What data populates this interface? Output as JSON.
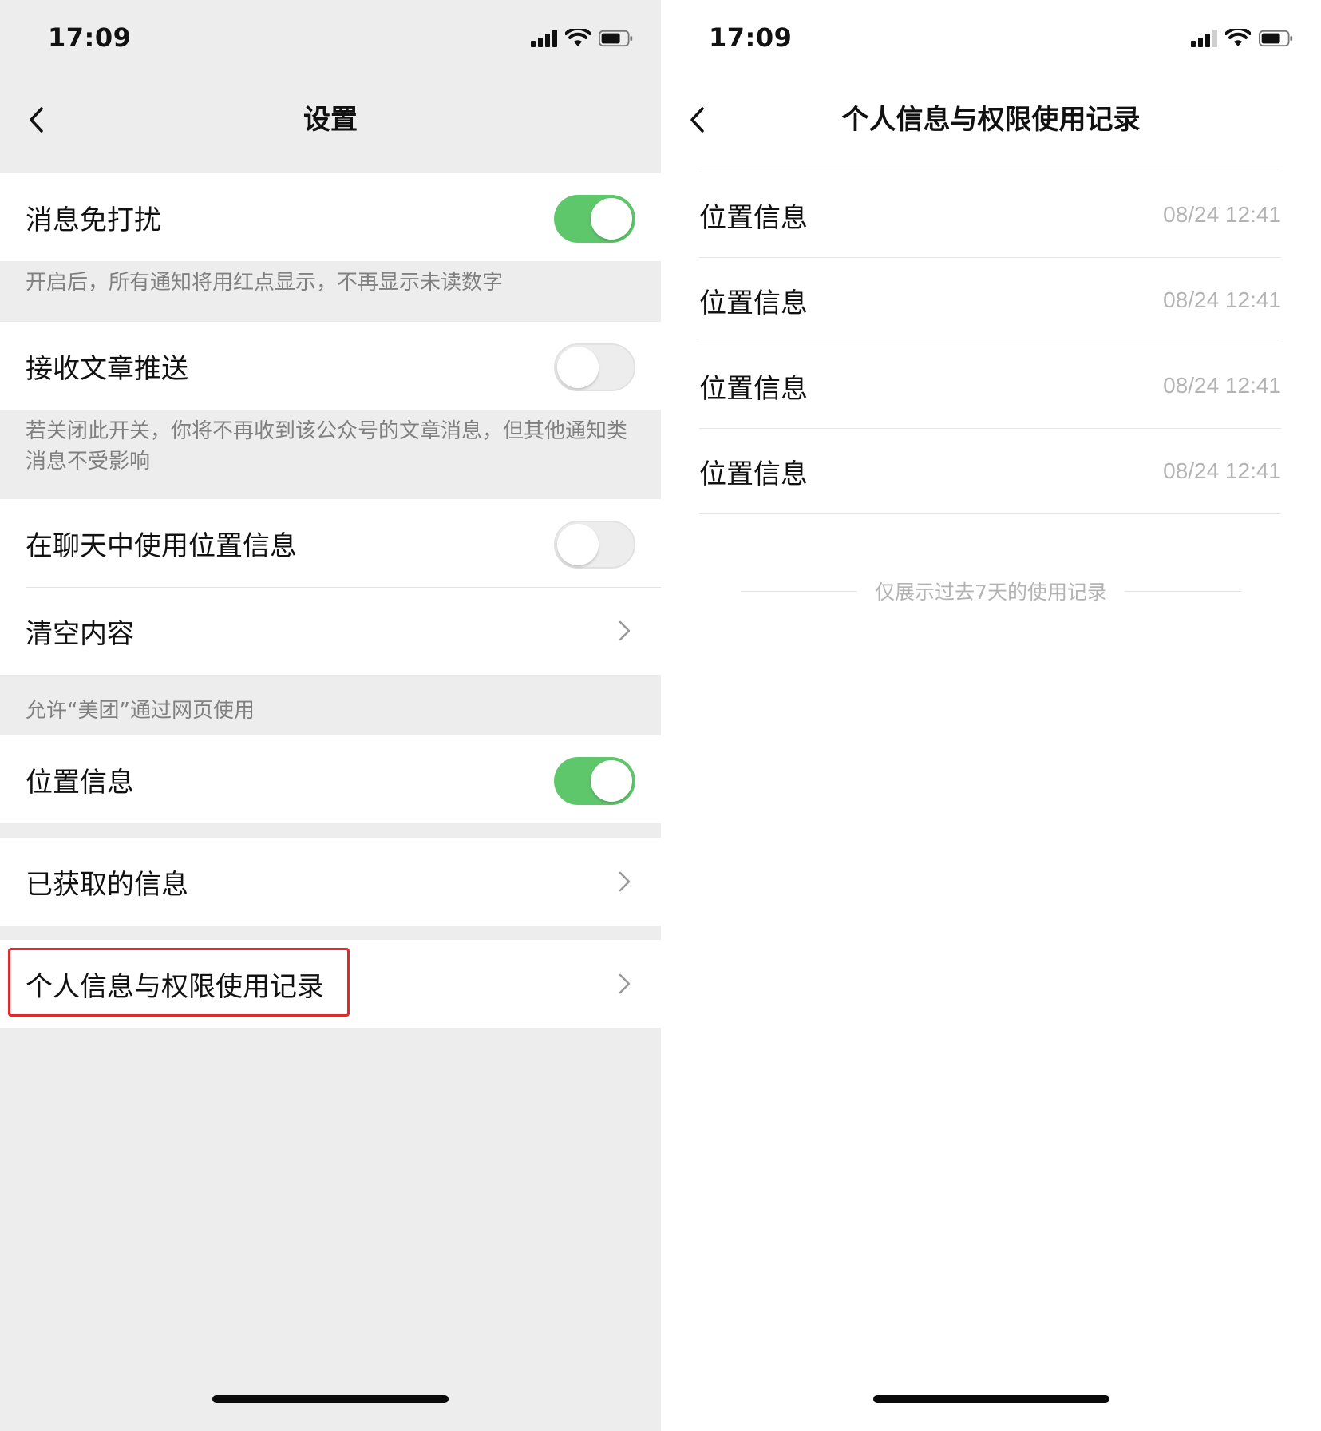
{
  "status_bar": {
    "time": "17:09"
  },
  "settings": {
    "title": "设置",
    "dnd": {
      "label": "消息免打扰",
      "enabled": true,
      "note": "开启后，所有通知将用红点显示，不再显示未读数字"
    },
    "article_push": {
      "label": "接收文章推送",
      "enabled": false,
      "note": "若关闭此开关，你将不再收到该公众号的文章消息，但其他通知类消息不受影响"
    },
    "chat_location": {
      "label": "在聊天中使用位置信息",
      "enabled": false
    },
    "clear_content": {
      "label": "清空内容"
    },
    "web_section_header": "允许“美团”通过网页使用",
    "location_info": {
      "label": "位置信息",
      "enabled": true
    },
    "obtained_info": {
      "label": "已获取的信息"
    },
    "privacy_records": {
      "label": "个人信息与权限使用记录"
    }
  },
  "records_page": {
    "title": "个人信息与权限使用记录",
    "records": [
      {
        "name": "位置信息",
        "time": "08/24 12:41"
      },
      {
        "name": "位置信息",
        "time": "08/24 12:41"
      },
      {
        "name": "位置信息",
        "time": "08/24 12:41"
      },
      {
        "name": "位置信息",
        "time": "08/24 12:41"
      }
    ],
    "footer_note": "仅展示过去7天的使用记录"
  },
  "colors": {
    "toggle_on": "#5fc76b",
    "highlight": "#e02a2a",
    "page_bg": "#ededed"
  }
}
